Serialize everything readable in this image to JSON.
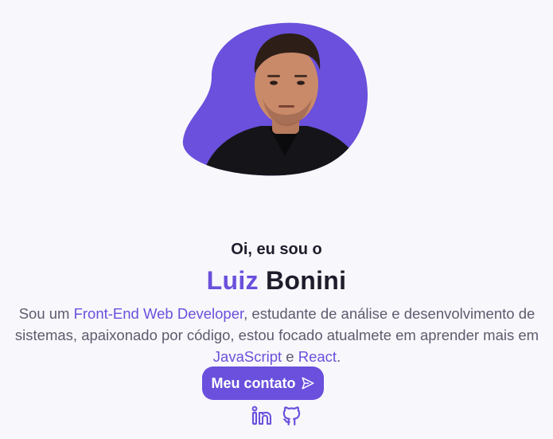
{
  "colors": {
    "accent": "#6a50dc",
    "background": "#f8f7fc",
    "heading": "#1f1d2b",
    "body_text": "#5f5a6e"
  },
  "profile": {
    "photo_icon": "profile-photo",
    "greeting": "Oi, eu sou o",
    "first_name": "Luiz",
    "last_name": "Bonini"
  },
  "bio": {
    "part1": "Sou um ",
    "highlight1": "Front-End Web Developer",
    "part2": ", estudante de análise e desenvolvimento de sistemas, apaixonado por código, estou focado atualmete em aprender mais em ",
    "highlight2": "JavaScript",
    "part3": " e ",
    "highlight3": "React",
    "part4": "."
  },
  "contact_button": {
    "label": "Meu contato",
    "icon": "send-icon"
  },
  "socials": [
    {
      "name": "LinkedIn",
      "icon": "linkedin-icon"
    },
    {
      "name": "GitHub",
      "icon": "github-icon"
    }
  ]
}
